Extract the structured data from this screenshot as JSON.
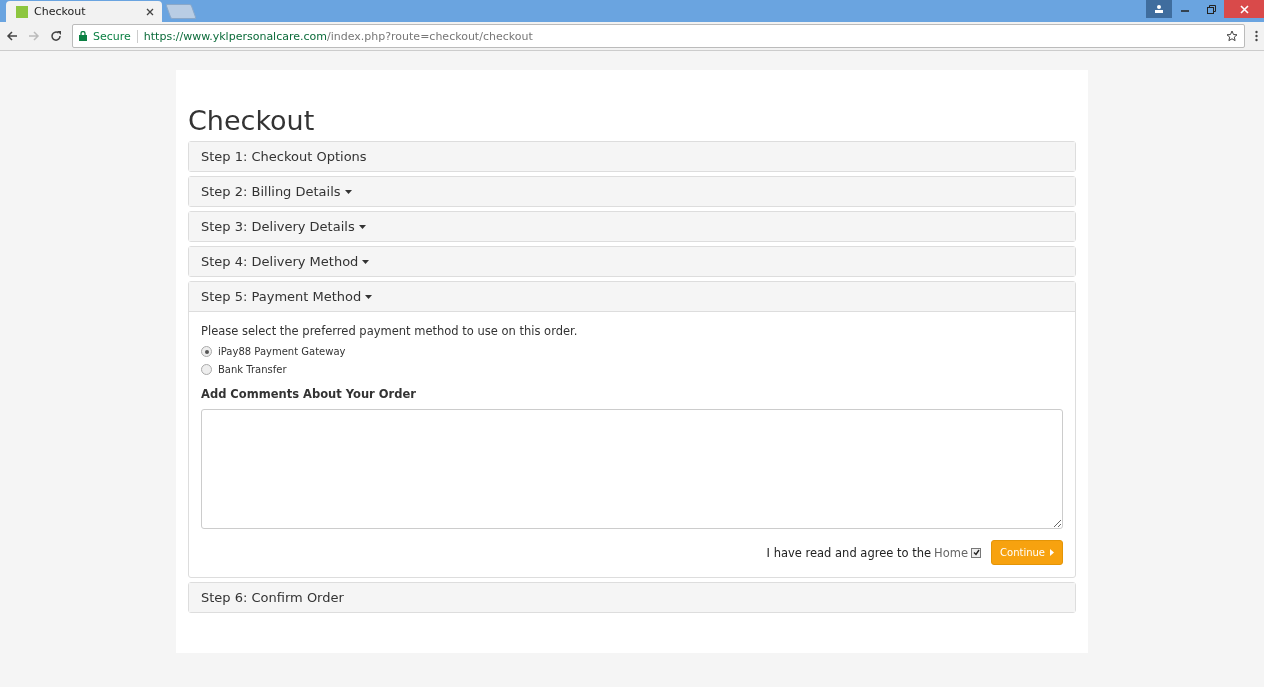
{
  "browser": {
    "tab": {
      "title": "Checkout"
    },
    "security": "Secure",
    "url_host": "https://www.yklpersonalcare.com",
    "url_path": "/index.php?route=checkout/checkout"
  },
  "page": {
    "title": "Checkout",
    "steps": [
      {
        "label": "Step 1: Checkout Options",
        "has_caret": false,
        "expanded": false
      },
      {
        "label": "Step 2: Billing Details",
        "has_caret": true,
        "expanded": false
      },
      {
        "label": "Step 3: Delivery Details",
        "has_caret": true,
        "expanded": false
      },
      {
        "label": "Step 4: Delivery Method",
        "has_caret": true,
        "expanded": false
      },
      {
        "label": "Step 5: Payment Method",
        "has_caret": true,
        "expanded": true
      },
      {
        "label": "Step 6: Confirm Order",
        "has_caret": false,
        "expanded": false
      }
    ],
    "payment": {
      "intro": "Please select the preferred payment method to use on this order.",
      "options": [
        {
          "label": "iPay88 Payment Gateway",
          "selected": true
        },
        {
          "label": "Bank Transfer",
          "selected": false
        }
      ],
      "comments_label": "Add Comments About Your Order",
      "agree_text": "I have read and agree to the",
      "agree_link": "Home",
      "agree_checked": true,
      "continue": "Continue"
    }
  }
}
